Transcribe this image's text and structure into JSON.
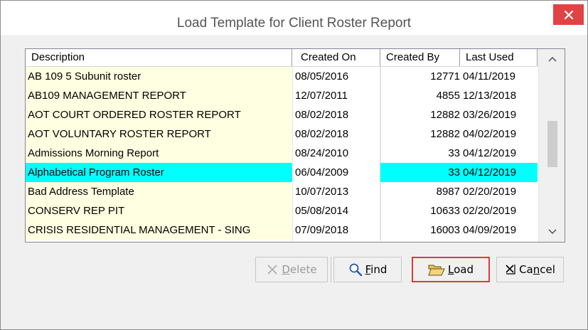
{
  "window": {
    "title": "Load Template for Client Roster Report",
    "close_glyph": "×"
  },
  "table": {
    "headers": {
      "description": "Description",
      "created_on": "Created On",
      "created_by": "Created By",
      "last_used": "Last Used"
    },
    "rows": [
      {
        "description": "AB 109 5 Subunit roster",
        "created_on": "08/05/2016",
        "created_by": "12771",
        "last_used": "04/11/2019"
      },
      {
        "description": "AB109 MANAGEMENT REPORT",
        "created_on": "12/07/2011",
        "created_by": "4855",
        "last_used": "12/13/2018"
      },
      {
        "description": "AOT COURT ORDERED ROSTER REPORT",
        "created_on": "08/02/2018",
        "created_by": "12882",
        "last_used": "03/26/2019"
      },
      {
        "description": "AOT VOLUNTARY ROSTER REPORT",
        "created_on": "08/02/2018",
        "created_by": "12882",
        "last_used": "04/02/2019"
      },
      {
        "description": "Admissions Morning Report",
        "created_on": "08/24/2010",
        "created_by": "33",
        "last_used": "04/12/2019"
      },
      {
        "description": "Alphabetical Program Roster",
        "created_on": "06/04/2009",
        "created_by": "33",
        "last_used": "04/12/2019"
      },
      {
        "description": "Bad Address Template",
        "created_on": "10/07/2013",
        "created_by": "8987",
        "last_used": "02/20/2019"
      },
      {
        "description": "CONSERV REP PIT",
        "created_on": "05/08/2014",
        "created_by": "10633",
        "last_used": "02/20/2019"
      },
      {
        "description": "CRISIS RESIDENTIAL MANAGEMENT - SING",
        "created_on": "07/09/2018",
        "created_by": "16003",
        "last_used": "04/09/2019"
      }
    ],
    "selected_index": 5
  },
  "buttons": {
    "delete": {
      "underline": "D",
      "rest": "elete",
      "icon": "x-icon"
    },
    "find": {
      "underline": "F",
      "rest": "ind",
      "icon": "magnifier-icon"
    },
    "load": {
      "underline": "L",
      "rest": "oad",
      "icon": "open-folder-icon"
    },
    "cancel": {
      "prefix": "Ca",
      "underline": "n",
      "rest": "cel",
      "icon": "x-close-icon"
    }
  },
  "colors": {
    "selected_row": "#00ffff",
    "description_bg": "#ffffe1",
    "highlight_border": "#e03a3a",
    "close_button": "#e04343"
  }
}
